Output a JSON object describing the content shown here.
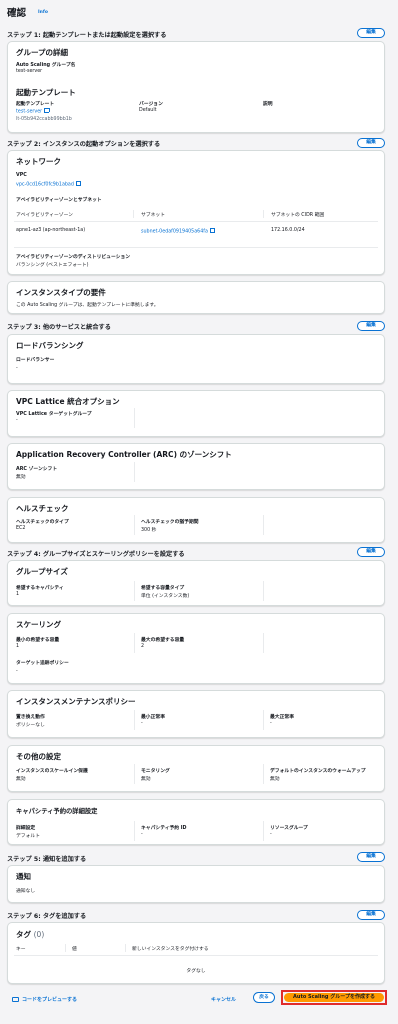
{
  "page": {
    "title": "確認",
    "info": "Info"
  },
  "step1": {
    "title": "ステップ 1: 起動テンプレートまたは起動設定を選択する",
    "edit": "編集",
    "group_details": {
      "title": "グループの詳細",
      "name_label": "Auto Scaling グループ名",
      "name_value": "test-server"
    },
    "launch_template": {
      "title": "起動テンプレート",
      "template_label": "起動テンプレート",
      "template_link": "test-server",
      "template_id": "lt-05b942ccabb99bb1b",
      "version_label": "バージョン",
      "version_value": "Default",
      "description_label": "説明"
    }
  },
  "step2": {
    "title": "ステップ 2: インスタンスの起動オプションを選択する",
    "edit": "編集",
    "network": {
      "title": "ネットワーク",
      "vpc_label": "VPC",
      "vpc_link": "vpc-0cd16cf0fc9b1abad",
      "az_subnet_title": "アベイラビリティーゾーンとサブネット",
      "columns": [
        "アベイラビリティーゾーン",
        "サブネット",
        "サブネットの CIDR 範囲"
      ],
      "row": {
        "az": "apne1-az3 (ap-northeast-1a)",
        "subnet": "subnet-0edaf0919405a64fa",
        "cidr": "172.16.0.0/24"
      },
      "distribution_label": "アベイラビリティーゾーンのディストリビューション",
      "distribution_value": "バランシング (ベストエフォート)"
    },
    "instance_type": {
      "title": "インスタンスタイプの要件",
      "text": "この Auto Scaling グループは、起動テンプレートに準拠します。"
    }
  },
  "step3": {
    "title": "ステップ 3: 他のサービスと統合する",
    "edit": "編集",
    "lb": {
      "title": "ロードバランシング",
      "label": "ロードバランサー",
      "value": "-"
    },
    "vpc_lattice": {
      "title": "VPC Lattice 統合オプション",
      "label": "VPC Lattice ターゲットグループ",
      "value": "-"
    },
    "arc": {
      "title": "Application Recovery Controller (ARC) のゾーンシフト",
      "label": "ARC ゾーンシフト",
      "value": "無効"
    },
    "health": {
      "title": "ヘルスチェック",
      "type_label": "ヘルスチェックのタイプ",
      "type_value": "EC2",
      "grace_label": "ヘルスチェックの猶予期間",
      "grace_value": "300 秒"
    }
  },
  "step4": {
    "title": "ステップ 4: グループサイズとスケーリングポリシーを設定する",
    "edit": "編集",
    "group_size": {
      "title": "グループサイズ",
      "desired_label": "希望するキャパシティ",
      "desired_value": "1",
      "unit_label": "希望する容量タイプ",
      "unit_value": "単位 (インスタンス数)"
    },
    "scaling": {
      "title": "スケーリング",
      "min_label": "最小の希望する容量",
      "min_value": "1",
      "max_label": "最大の希望する容量",
      "max_value": "2",
      "policy_label": "ターゲット追跡ポリシー",
      "policy_value": "-"
    },
    "maintenance": {
      "title": "インスタンスメンテナンスポリシー",
      "replace_label": "置き換え動作",
      "replace_value": "ポリシーなし",
      "min_healthy_label": "最小正常率",
      "min_healthy_value": "-",
      "max_healthy_label": "最大正常率",
      "max_healthy_value": "-"
    },
    "other": {
      "title": "その他の設定",
      "scalein_label": "インスタンスのスケールイン保護",
      "scalein_value": "無効",
      "monitoring_label": "モニタリング",
      "monitoring_value": "無効",
      "warmup_label": "デフォルトのインスタンスのウォームアップ",
      "warmup_value": "無効"
    },
    "capacity": {
      "title": "キャパシティ予約の詳細設定",
      "detail_label": "詳細設定",
      "detail_value": "デフォルト",
      "id_label": "キャパシティ予約 ID",
      "id_value": "-",
      "rg_label": "リソースグループ",
      "rg_value": "-"
    }
  },
  "step5": {
    "title": "ステップ 5: 通知を追加する",
    "edit": "編集",
    "notify": {
      "title": "通知",
      "value": "通知なし"
    }
  },
  "step6": {
    "title": "ステップ 6: タグを追加する",
    "edit": "編集",
    "tags": {
      "title": "タグ",
      "count": "(0)",
      "columns": [
        "キー",
        "値",
        "新しいインスタンスをタグ付けする"
      ],
      "empty": "タグなし"
    }
  },
  "footer": {
    "preview": "コードをプレビューする",
    "cancel": "キャンセル",
    "back": "戻る",
    "create": "Auto Scaling グループを作成する"
  },
  "colors": {
    "accent": "#0972d3",
    "primary_button": "#ff9900",
    "highlight_border": "#e02c2c"
  }
}
